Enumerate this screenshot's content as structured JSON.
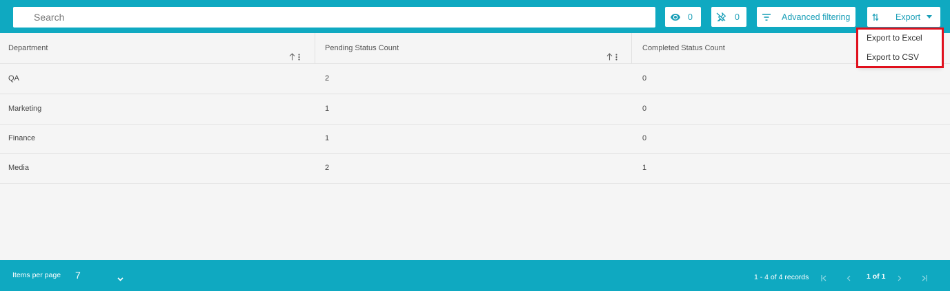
{
  "toolbar": {
    "search_placeholder": "Search",
    "visible_count": "0",
    "pinned_count": "0",
    "advanced_filtering_label": "Advanced filtering",
    "export_label": "Export"
  },
  "export_menu": {
    "items": [
      "Export to Excel",
      "Export to CSV"
    ]
  },
  "table": {
    "columns": [
      "Department",
      "Pending Status Count",
      "Completed Status Count"
    ],
    "rows": [
      [
        "QA",
        "2",
        "0"
      ],
      [
        "Marketing",
        "1",
        "0"
      ],
      [
        "Finance",
        "1",
        "0"
      ],
      [
        "Media",
        "2",
        "1"
      ]
    ]
  },
  "footer": {
    "items_per_page_label": "Items per page",
    "items_per_page_value": "7",
    "records_text": "1 - 4 of 4 records",
    "page_text": "1 of 1"
  },
  "colors": {
    "accent": "#0fa9c1",
    "highlight": "#e0101d"
  }
}
